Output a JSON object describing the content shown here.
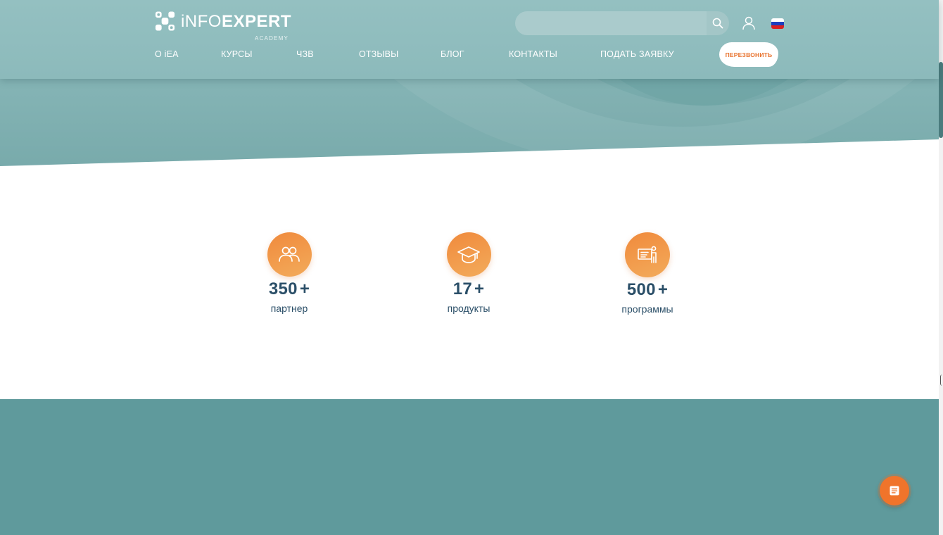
{
  "header": {
    "logo": {
      "brand_light": "iNFO",
      "brand_bold": "EXPERT",
      "subtitle": "ACADEMY"
    },
    "search": {
      "placeholder": "",
      "value": "",
      "icon": "search-icon"
    },
    "user_icon": "user-icon",
    "language": {
      "flag": "russia-flag",
      "colors": [
        "#ffffff",
        "#1d3fbf",
        "#d92020"
      ]
    },
    "nav": [
      {
        "label": "О iEA"
      },
      {
        "label": "КУРСЫ"
      },
      {
        "label": "ЧЗВ"
      },
      {
        "label": "ОТЗЫВЫ"
      },
      {
        "label": "БЛОГ"
      },
      {
        "label": "КОНТАКТЫ"
      },
      {
        "label": "ПОДАТЬ ЗАЯВКУ"
      }
    ],
    "callback_label": "ПЕРЕЗВОНИТЬ"
  },
  "stats": [
    {
      "icon": "partners-icon",
      "value": "350",
      "suffix": "+",
      "label": "партнер"
    },
    {
      "icon": "graduation-cap-icon",
      "value": "17",
      "suffix": "+",
      "label": "продукты"
    },
    {
      "icon": "presentation-icon",
      "value": "500",
      "suffix": "+",
      "label": "программы"
    }
  ],
  "chat_button": {
    "icon": "chat-icon"
  },
  "colors": {
    "teal_header": "#8cbabb",
    "teal_band": "#5f9a9c",
    "orange_accent": "#f0742b",
    "stat_text": "#2b4f68"
  }
}
